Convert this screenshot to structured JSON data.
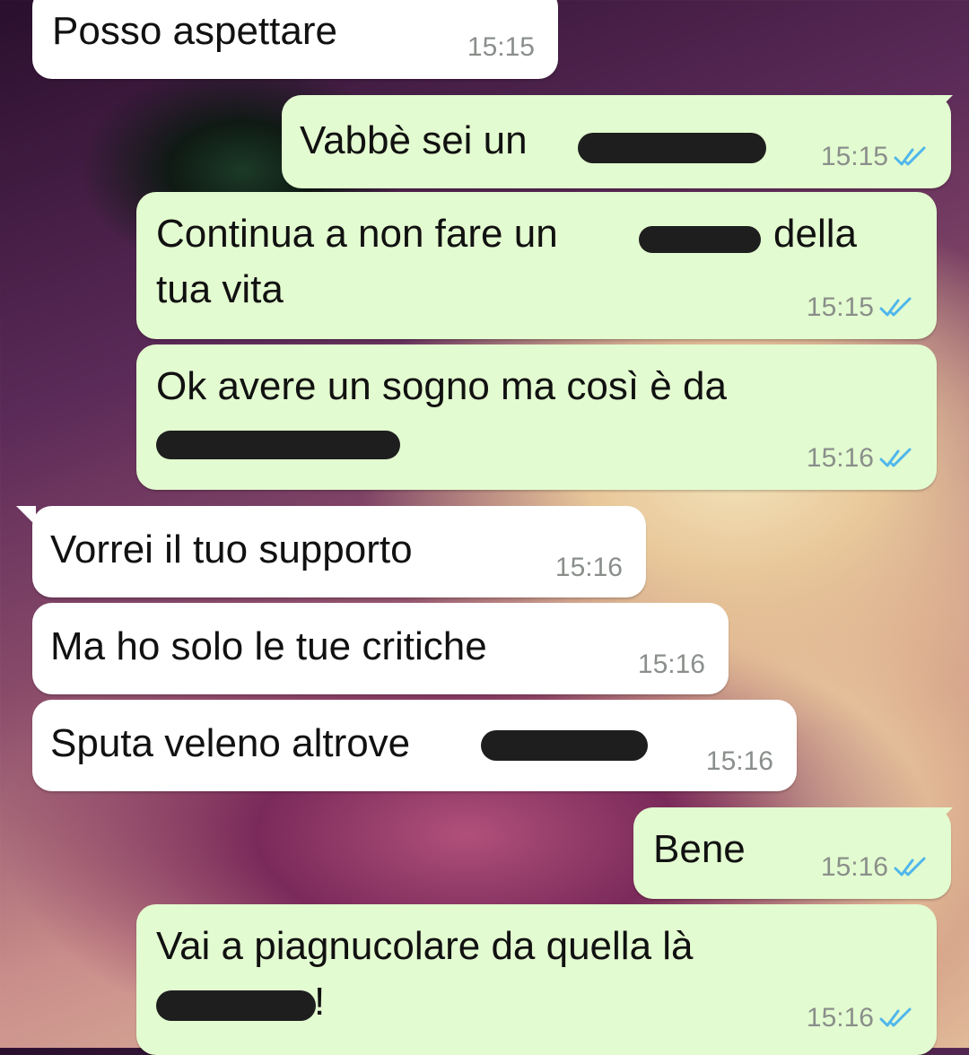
{
  "colors": {
    "incoming_bubble": "#ffffff",
    "outgoing_bubble": "#e3fbd0",
    "timestamp": "#8a8f8b",
    "read_ticks": "#4fb6ec",
    "redaction": "#1e1e1e"
  },
  "messages": [
    {
      "direction": "in",
      "lines": [
        "Posso aspettare"
      ],
      "time": "15:15"
    },
    {
      "direction": "out",
      "lines": [
        "Vabbè sei un"
      ],
      "time": "15:15",
      "status_icon": "double-check-icon"
    },
    {
      "direction": "out",
      "lines": [
        "Continua a non fare un",
        "della",
        "tua vita"
      ],
      "time": "15:15",
      "status_icon": "double-check-icon"
    },
    {
      "direction": "out",
      "lines": [
        "Ok avere un sogno ma così è da"
      ],
      "time": "15:16",
      "status_icon": "double-check-icon"
    },
    {
      "direction": "in",
      "lines": [
        "Vorrei il tuo supporto"
      ],
      "time": "15:16"
    },
    {
      "direction": "in",
      "lines": [
        "Ma ho solo le tue critiche"
      ],
      "time": "15:16"
    },
    {
      "direction": "in",
      "lines": [
        "Sputa veleno altrove"
      ],
      "time": "15:16"
    },
    {
      "direction": "out",
      "lines": [
        "Bene"
      ],
      "time": "15:16",
      "status_icon": "double-check-icon"
    },
    {
      "direction": "out",
      "lines": [
        "Vai a piagnucolare da quella là",
        "!"
      ],
      "time": "15:16",
      "status_icon": "double-check-icon"
    }
  ]
}
